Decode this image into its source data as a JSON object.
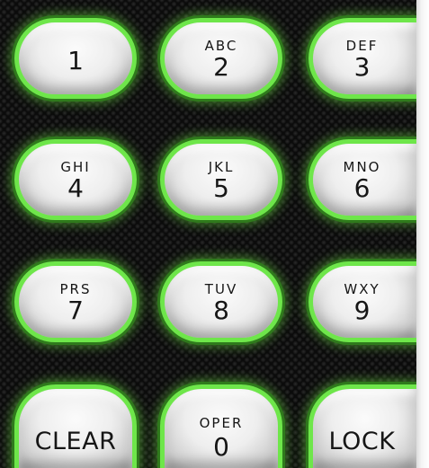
{
  "keypad": {
    "keys": [
      {
        "digit": "1",
        "letters": "",
        "word": ""
      },
      {
        "digit": "2",
        "letters": "ABC",
        "word": ""
      },
      {
        "digit": "3",
        "letters": "DEF",
        "word": ""
      },
      {
        "digit": "4",
        "letters": "GHI",
        "word": ""
      },
      {
        "digit": "5",
        "letters": "JKL",
        "word": ""
      },
      {
        "digit": "6",
        "letters": "MNO",
        "word": ""
      },
      {
        "digit": "7",
        "letters": "PRS",
        "word": ""
      },
      {
        "digit": "8",
        "letters": "TUV",
        "word": ""
      },
      {
        "digit": "9",
        "letters": "WXY",
        "word": ""
      },
      {
        "digit": "",
        "letters": "",
        "word": "CLEAR"
      },
      {
        "digit": "0",
        "letters": "OPER",
        "word": ""
      },
      {
        "digit": "",
        "letters": "",
        "word": "LOCK"
      }
    ]
  },
  "colors": {
    "glow": "#6ee64a",
    "glow_dark": "#2f7a1c",
    "panel": "#0b0b0b",
    "key_face": "#eeeeee",
    "key_text": "#161616"
  },
  "icons": {
    "background": "speaker-grille-texture"
  }
}
